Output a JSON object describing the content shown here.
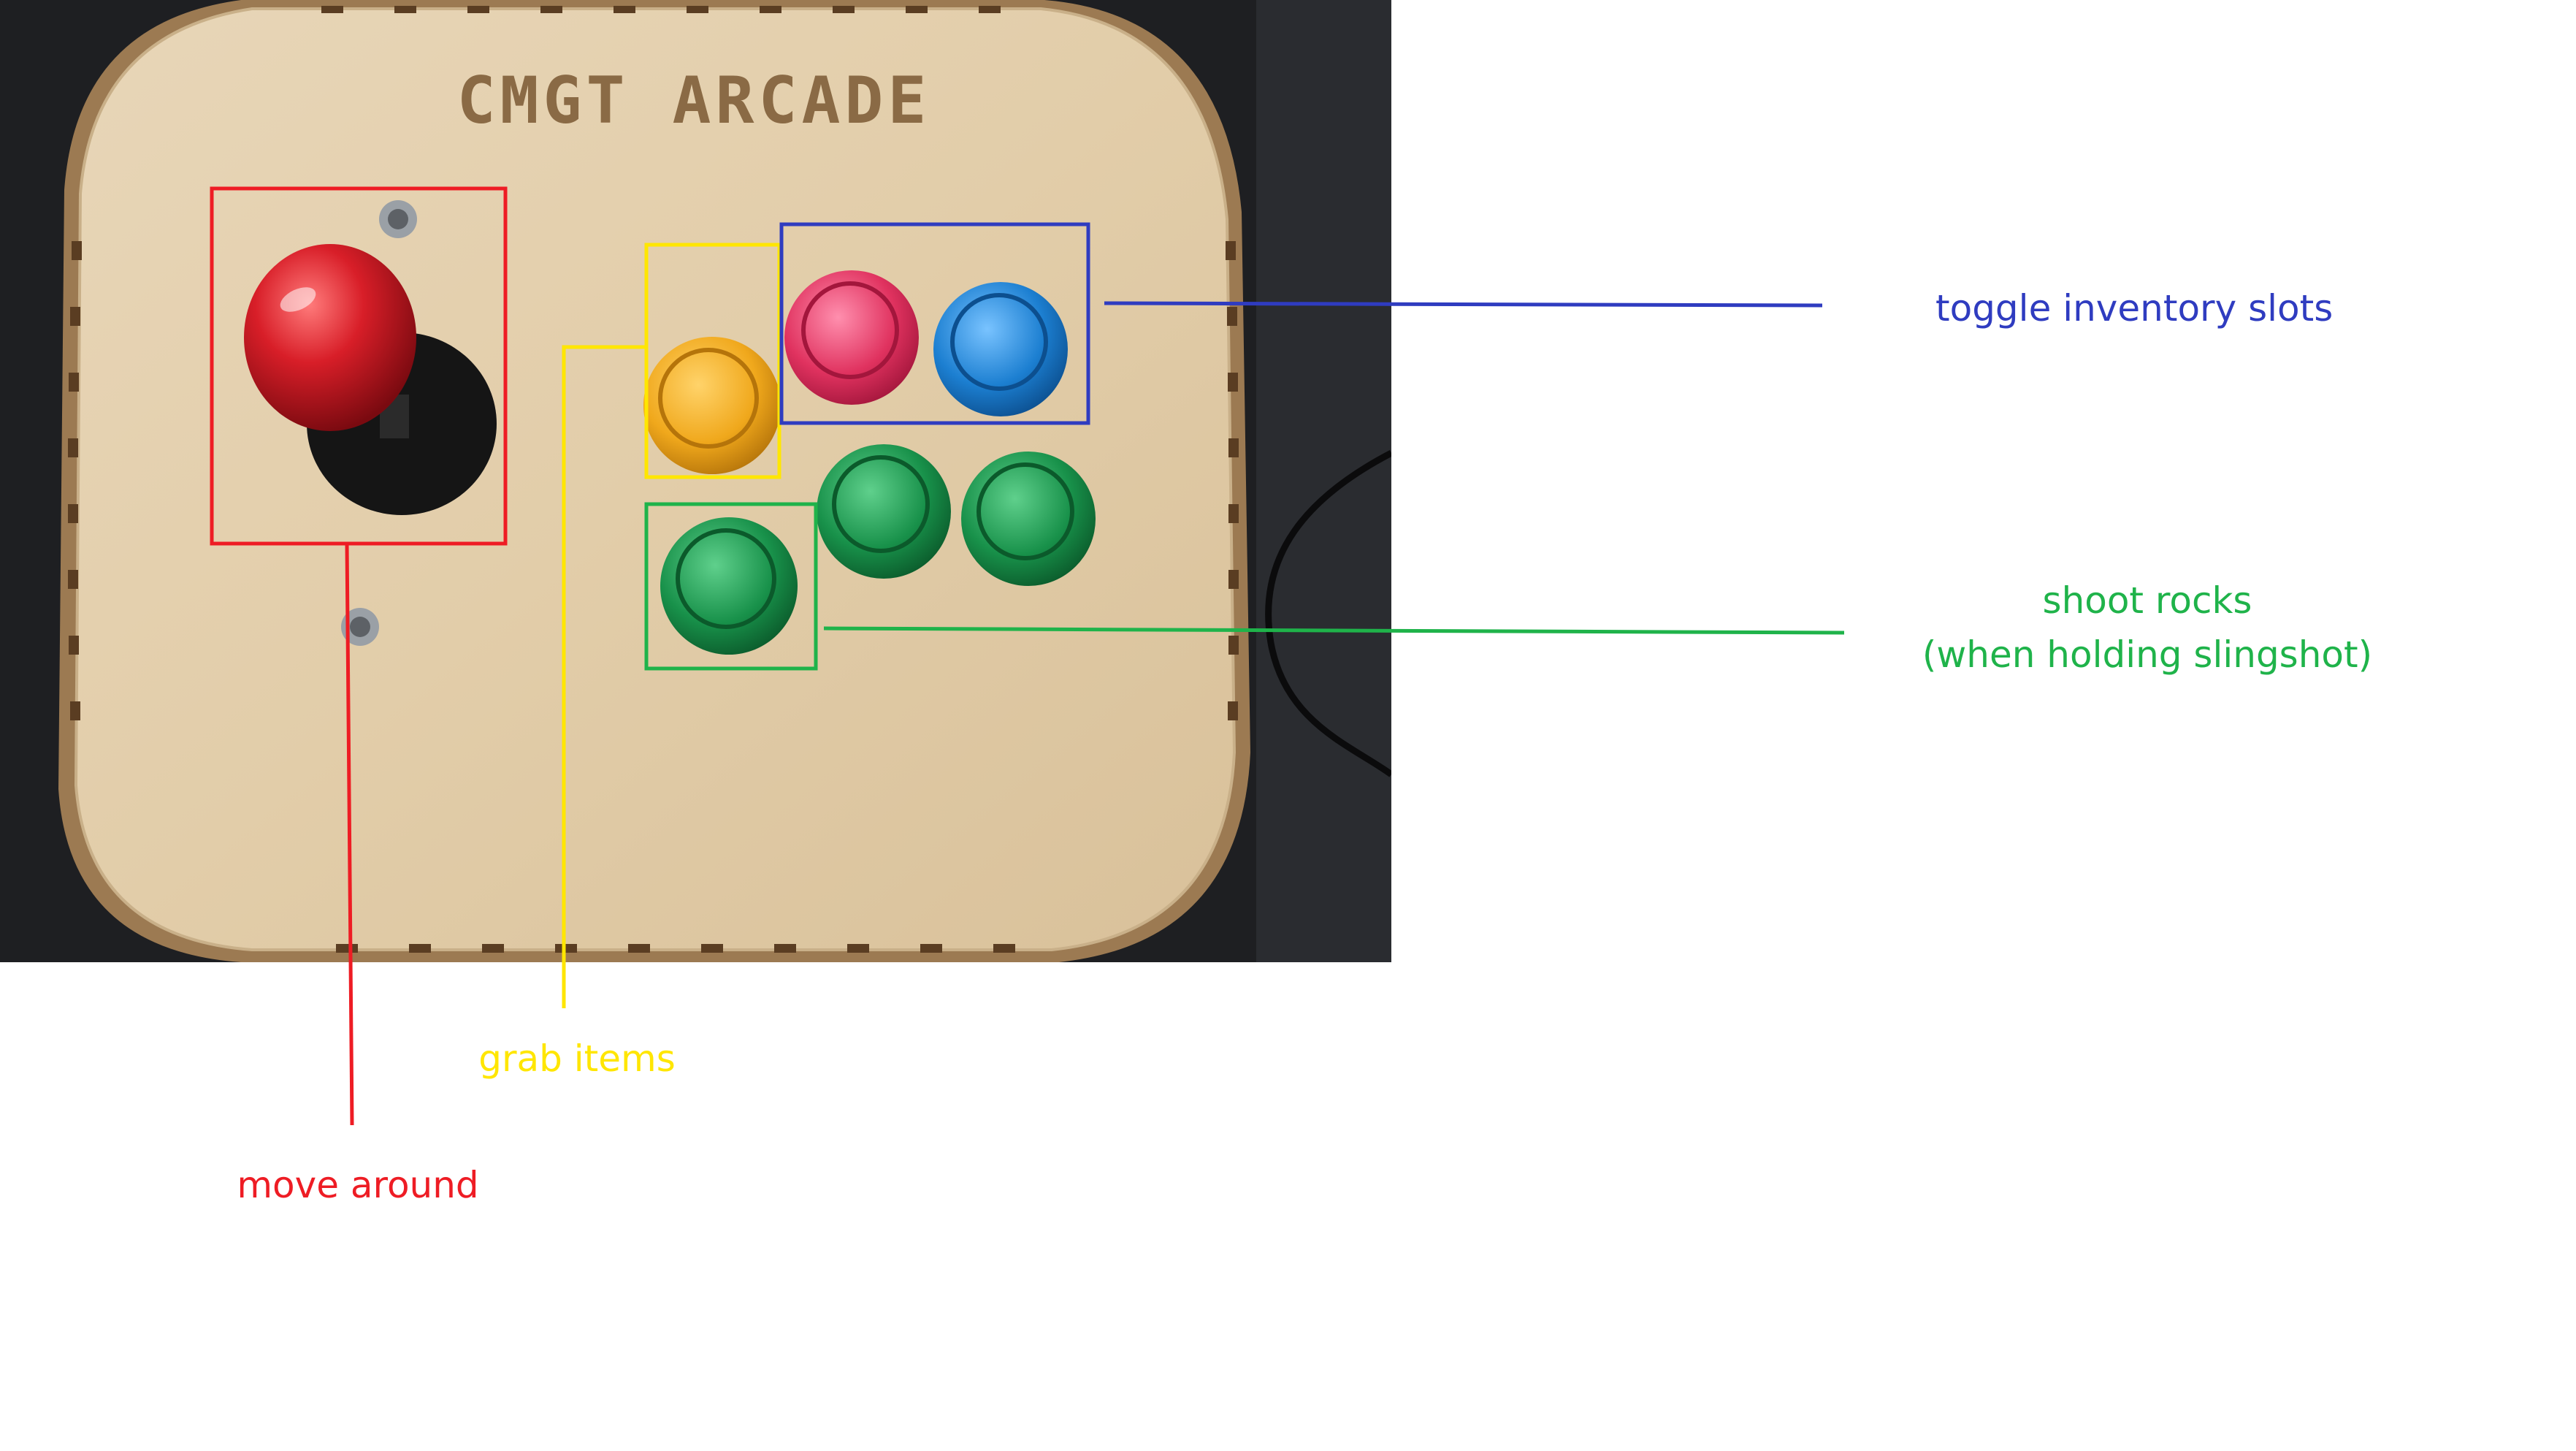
{
  "photo": {
    "engraved_title": "CMGT ARCADE",
    "colors": {
      "backdrop": "#1e1f22",
      "wood": "#e3cfb0",
      "wood_edge": "#c9b089",
      "joystick_ball": "#cf1b24",
      "yellow_button": "#f0a81c",
      "pink_button": "#e0325f",
      "blue_button": "#1c7fd1",
      "green_button": "#18914a"
    }
  },
  "annotations": [
    {
      "id": "move",
      "text": "move around",
      "color": "#ee1c24"
    },
    {
      "id": "grab",
      "text": "grab items",
      "color": "#ffe600"
    },
    {
      "id": "inventory",
      "text": "toggle inventory slots",
      "color": "#2f3cc0"
    },
    {
      "id": "shoot",
      "lines": [
        "shoot rocks",
        "(when holding slingshot)"
      ],
      "color": "#1fb34a"
    }
  ]
}
